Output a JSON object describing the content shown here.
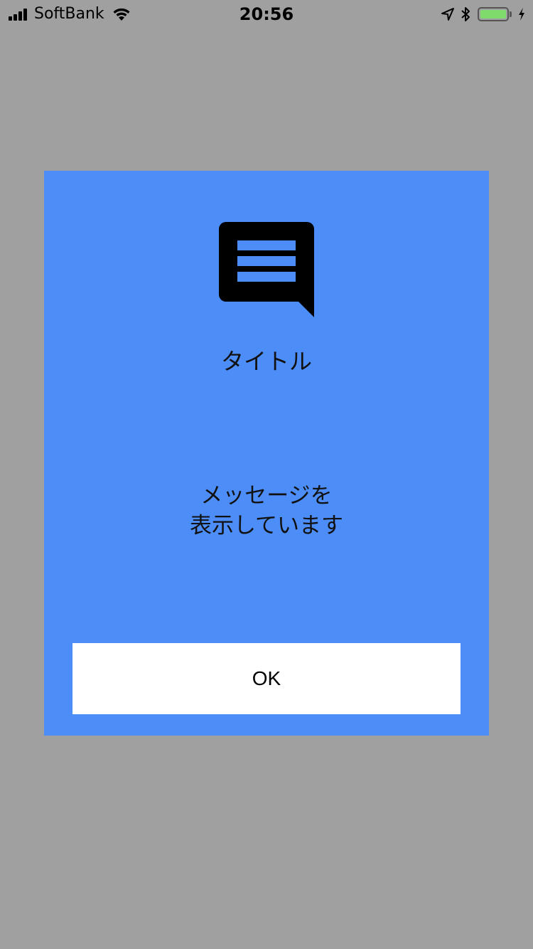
{
  "status_bar": {
    "carrier": "SoftBank",
    "time": "20:56",
    "signal_bars": 4,
    "battery_level": 1.0,
    "battery_color": "#7fdc6c",
    "icons": [
      "signal-icon",
      "wifi-icon",
      "location-arrow-icon",
      "bluetooth-icon",
      "battery-icon",
      "charging-bolt-icon"
    ]
  },
  "dialog": {
    "background_color": "#4d8df8",
    "icon": "message-bubble-icon",
    "title": "タイトル",
    "message_lines": [
      "メッセージを",
      "表示しています"
    ],
    "ok_label": "OK"
  },
  "overlay_color": "#a0a0a0"
}
